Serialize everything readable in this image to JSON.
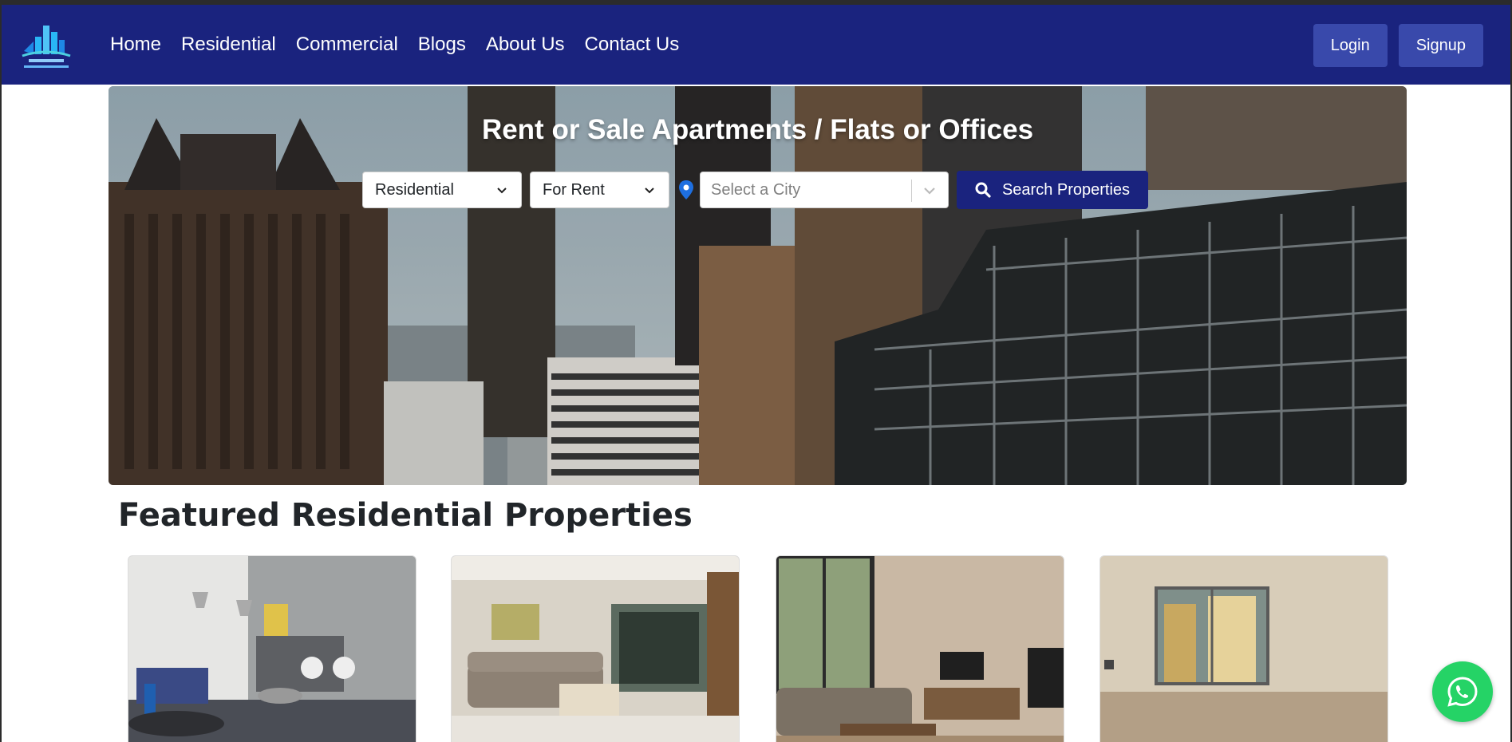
{
  "brand": {
    "logo_icon": "real-estate-logo",
    "color": "#1a237e"
  },
  "nav": {
    "links": [
      "Home",
      "Residential",
      "Commercial",
      "Blogs",
      "About Us",
      "Contact Us"
    ],
    "login_label": "Login",
    "signup_label": "Signup"
  },
  "hero": {
    "title": "Rent or Sale Apartments / Flats or Offices",
    "property_type": "Residential",
    "listing_mode": "For Rent",
    "city_placeholder": "Select a City",
    "search_label": "Search Properties"
  },
  "featured": {
    "title": "Featured Residential Properties",
    "cards": [
      {
        "image": "living-room-grey-photo"
      },
      {
        "image": "living-room-sofa-photo"
      },
      {
        "image": "living-room-tv-photo"
      },
      {
        "image": "empty-room-balcony-photo"
      }
    ]
  },
  "floating": {
    "icon": "whatsapp-icon",
    "color": "#25d366"
  }
}
